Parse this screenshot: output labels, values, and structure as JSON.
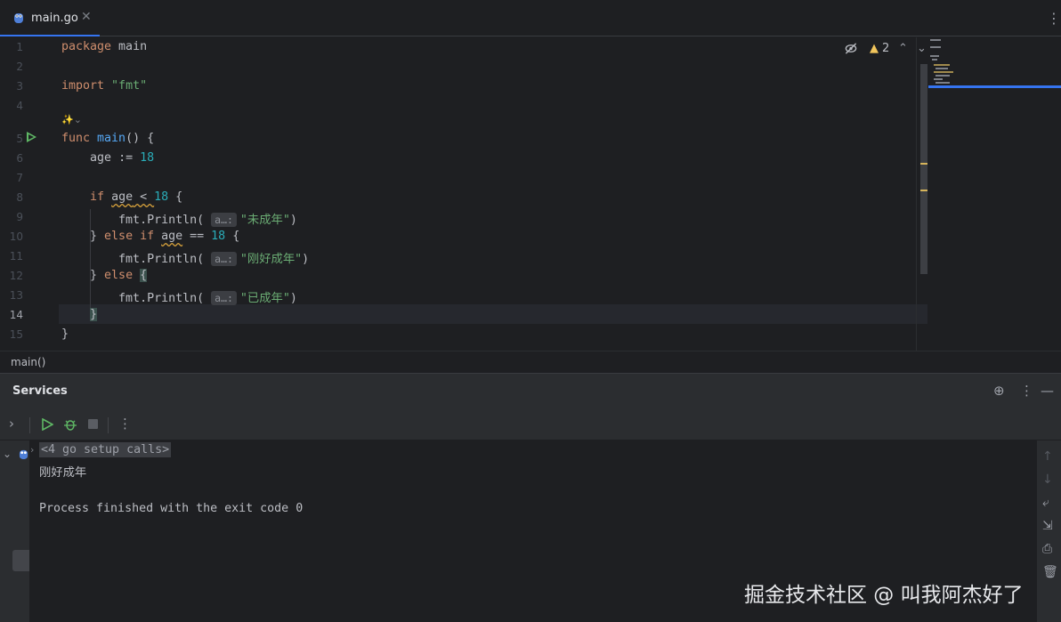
{
  "tab": {
    "label": "main.go",
    "icon": "gopher-icon",
    "close": "✕",
    "menu": "⋮"
  },
  "inspection": {
    "warning_count": "2"
  },
  "editor": {
    "line_numbers": [
      "1",
      "2",
      "3",
      "4",
      "5",
      "6",
      "7",
      "8",
      "9",
      "10",
      "11",
      "12",
      "13",
      "14",
      "15"
    ],
    "current_line": "14",
    "lines": {
      "l1_kw": "package",
      "l1_rest": " main",
      "l3_kw": "import",
      "l3_str": " \"fmt\"",
      "l4_hint": "✨⌄",
      "l5_kw": "func",
      "l5_fn": " main",
      "l5_rest": "() {",
      "l6_ident": "age",
      "l6_op": " := ",
      "l6_num": "18",
      "l8_kw": "if",
      "l8_ident": "age",
      "l8_op": " < ",
      "l8_num": "18",
      "l8_brace": " {",
      "l9_call": "fmt.Println(",
      "l9_hint": "a…:",
      "l9_str": "\"未成年\"",
      "l9_end": ")",
      "l10_brace": "} ",
      "l10_kw1": "else",
      "l10_kw2": " if ",
      "l10_ident": "age",
      "l10_op": " == ",
      "l10_num": "18",
      "l10_brace2": " {",
      "l11_call": "fmt.Println(",
      "l11_hint": "a…:",
      "l11_str": "\"刚好成年\"",
      "l11_end": ")",
      "l12_brace": "} ",
      "l12_kw": "else",
      "l12_brace2": "{",
      "l13_call": "fmt.Println(",
      "l13_hint": "a…:",
      "l13_str": "\"已成年\"",
      "l13_end": ")",
      "l14_brace": "}",
      "l15_brace": "}"
    }
  },
  "breadcrumb": "main()",
  "services": {
    "title": "Services",
    "console": {
      "setup_calls": "<4 go setup calls>",
      "output": "刚好成年",
      "exit_message": "Process finished with the exit code 0"
    }
  },
  "watermark": "掘金技术社区 @ 叫我阿杰好了",
  "colors": {
    "accent": "#3574f0",
    "run": "#5fb865",
    "warning": "#f2c55c",
    "keyword": "#cf8e6d",
    "string": "#6aab73",
    "number": "#2aacb8"
  }
}
